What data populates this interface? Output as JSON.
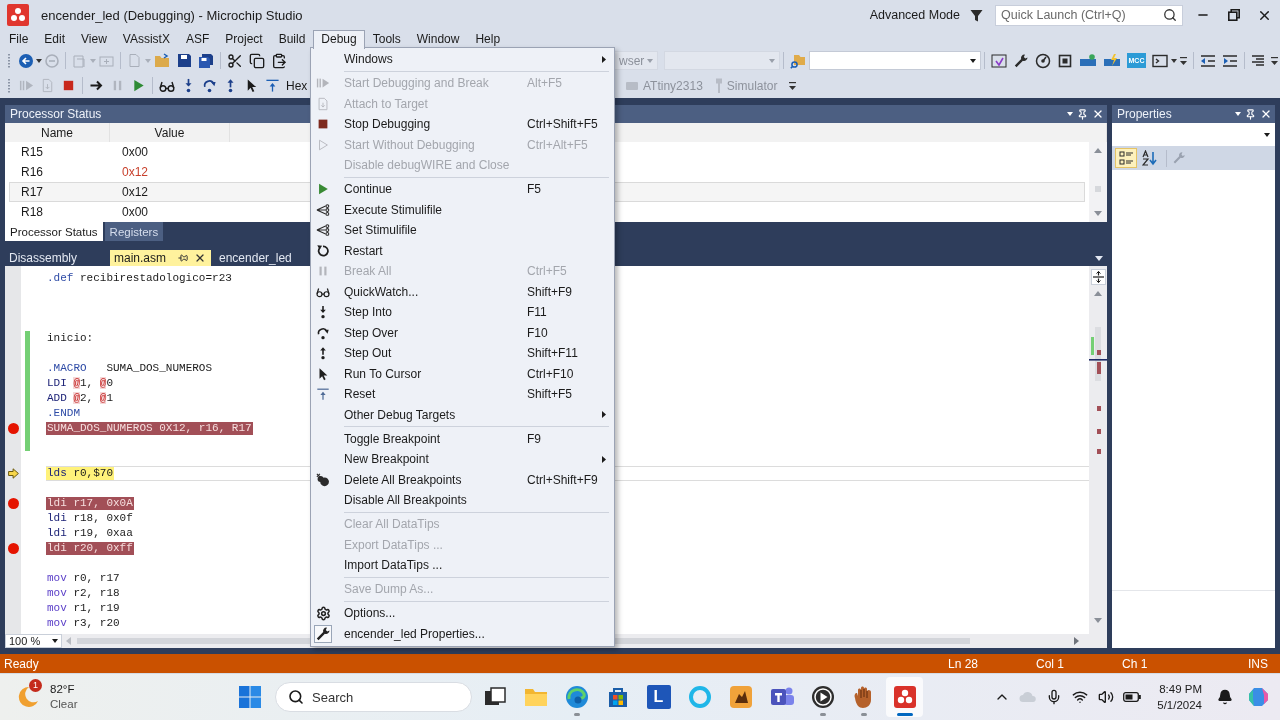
{
  "window": {
    "title": "encender_led (Debugging) - Microchip Studio",
    "mode": "Advanced Mode",
    "quick_launch": {
      "placeholder": "Quick Launch (Ctrl+Q)"
    }
  },
  "menu_bar": [
    {
      "label": "File",
      "selected": false
    },
    {
      "label": "Edit",
      "selected": false
    },
    {
      "label": "View",
      "selected": false
    },
    {
      "label": "VAssistX",
      "selected": false
    },
    {
      "label": "ASF",
      "selected": false
    },
    {
      "label": "Project",
      "selected": false
    },
    {
      "label": "Build",
      "selected": false
    },
    {
      "label": "Debug",
      "selected": true
    },
    {
      "label": "Tools",
      "selected": false
    },
    {
      "label": "Window",
      "selected": false
    },
    {
      "label": "Help",
      "selected": false
    }
  ],
  "toolbar": {
    "hex": "Hex",
    "browser_dropdown": "wser",
    "extension_tile": "MCC",
    "device": "ATtiny2313",
    "debugger": "Simulator"
  },
  "processor_status": {
    "title": "Processor Status",
    "columns": [
      "Name",
      "Value"
    ],
    "rows": [
      {
        "name": "R15",
        "value": "0x00",
        "changed": false,
        "selected": false
      },
      {
        "name": "R16",
        "value": "0x12",
        "changed": true,
        "selected": false
      },
      {
        "name": "R17",
        "value": "0x12",
        "changed": false,
        "selected": true
      },
      {
        "name": "R18",
        "value": "0x00",
        "changed": false,
        "selected": false
      }
    ],
    "tabs": [
      {
        "label": "Processor Status",
        "selected": true
      },
      {
        "label": "Registers",
        "selected": false
      }
    ]
  },
  "document_tabs": [
    {
      "label": "Disassembly",
      "selected": false
    },
    {
      "label": "main.asm",
      "selected": true
    },
    {
      "label": "encender_led",
      "selected": false
    }
  ],
  "editor": {
    "lines": [
      {
        "tokens": [
          {
            "kind": "directive",
            "text": ".def"
          },
          {
            "kind": "plain",
            "text": " recibirestadologico=r23"
          }
        ],
        "breakpoint": false,
        "current": false,
        "changed": false
      },
      {
        "breakpoint": false,
        "current": false,
        "changed": false
      },
      {
        "breakpoint": false,
        "current": false,
        "changed": false
      },
      {
        "breakpoint": false,
        "current": false,
        "changed": false
      },
      {
        "tokens": [
          {
            "kind": "plain",
            "text": "inicio:"
          }
        ],
        "breakpoint": false,
        "current": false,
        "changed": true
      },
      {
        "breakpoint": false,
        "current": false,
        "changed": true
      },
      {
        "tokens": [
          {
            "kind": "directive",
            "text": ".MACRO"
          },
          {
            "kind": "plain",
            "text": "   SUMA_DOS_NUMEROS"
          }
        ],
        "breakpoint": false,
        "current": false,
        "changed": true
      },
      {
        "tokens": [
          {
            "kind": "instruction",
            "text": "LDI "
          },
          {
            "kind": "macro_param",
            "text": "@"
          },
          {
            "kind": "plain",
            "text": "1, "
          },
          {
            "kind": "macro_param",
            "text": "@"
          },
          {
            "kind": "plain",
            "text": "0"
          }
        ],
        "breakpoint": false,
        "current": false,
        "changed": true
      },
      {
        "tokens": [
          {
            "kind": "instruction",
            "text": "ADD "
          },
          {
            "kind": "macro_param",
            "text": "@"
          },
          {
            "kind": "plain",
            "text": "2, "
          },
          {
            "kind": "macro_param",
            "text": "@"
          },
          {
            "kind": "plain",
            "text": "1"
          }
        ],
        "breakpoint": false,
        "current": false,
        "changed": true
      },
      {
        "tokens": [
          {
            "kind": "directive",
            "text": ".ENDM"
          }
        ],
        "breakpoint": false,
        "current": false,
        "changed": true
      },
      {
        "tokens": [
          {
            "kind": "plain",
            "text": "SUMA_DOS_NUMEROS 0X12, r16, R17"
          }
        ],
        "breakpoint": true,
        "current": false,
        "changed": true
      },
      {
        "breakpoint": false,
        "current": false,
        "changed": true
      },
      {
        "breakpoint": false,
        "current": false,
        "changed": false
      },
      {
        "tokens": [
          {
            "kind": "instruction",
            "text": "lds"
          },
          {
            "kind": "plain",
            "text": " r0,$70"
          }
        ],
        "breakpoint": false,
        "current": true,
        "changed": false
      },
      {
        "breakpoint": false,
        "current": false,
        "changed": false
      },
      {
        "tokens": [
          {
            "kind": "instruction",
            "text": "ldi"
          },
          {
            "kind": "plain",
            "text": " r17, 0x0A"
          }
        ],
        "breakpoint": true,
        "current": false,
        "changed": false
      },
      {
        "tokens": [
          {
            "kind": "instruction",
            "text": "ldi"
          },
          {
            "kind": "plain",
            "text": " r18, 0x0f"
          }
        ],
        "breakpoint": false,
        "current": false,
        "changed": false
      },
      {
        "tokens": [
          {
            "kind": "instruction",
            "text": "ldi"
          },
          {
            "kind": "plain",
            "text": " r19, 0xaa"
          }
        ],
        "breakpoint": false,
        "current": false,
        "changed": false
      },
      {
        "tokens": [
          {
            "kind": "instruction",
            "text": "ldi"
          },
          {
            "kind": "plain",
            "text": " r20, 0xff"
          }
        ],
        "breakpoint": true,
        "current": false,
        "changed": false
      },
      {
        "breakpoint": false,
        "current": false,
        "changed": false
      },
      {
        "tokens": [
          {
            "kind": "transfer",
            "text": "mov"
          },
          {
            "kind": "plain",
            "text": " r0, r17"
          }
        ],
        "breakpoint": false,
        "current": false,
        "changed": false
      },
      {
        "tokens": [
          {
            "kind": "transfer",
            "text": "mov"
          },
          {
            "kind": "plain",
            "text": " r2, r18"
          }
        ],
        "breakpoint": false,
        "current": false,
        "changed": false
      },
      {
        "tokens": [
          {
            "kind": "transfer",
            "text": "mov"
          },
          {
            "kind": "plain",
            "text": " r1, r19"
          }
        ],
        "breakpoint": false,
        "current": false,
        "changed": false
      },
      {
        "tokens": [
          {
            "kind": "transfer",
            "text": "mov"
          },
          {
            "kind": "plain",
            "text": " r3, r20"
          }
        ],
        "breakpoint": false,
        "current": false,
        "changed": false
      }
    ],
    "zoom": "100 %"
  },
  "properties": {
    "title": "Properties",
    "sort_buttons": [
      {
        "selected": true
      },
      {
        "selected": false
      }
    ]
  },
  "debug_menu": {
    "groups": [
      [
        {
          "label": "Windows",
          "submenu": true,
          "disabled": false
        }
      ],
      [
        {
          "label": "Start Debugging and Break",
          "shortcut": "Alt+F5",
          "submenu": false,
          "disabled": true
        },
        {
          "label": "Attach to Target",
          "submenu": false,
          "disabled": true
        },
        {
          "label": "Stop Debugging",
          "shortcut": "Ctrl+Shift+F5",
          "submenu": false,
          "disabled": false
        },
        {
          "label": "Start Without Debugging",
          "shortcut": "Ctrl+Alt+F5",
          "submenu": false,
          "disabled": true
        },
        {
          "label": "Disable debugWIRE and Close",
          "submenu": false,
          "disabled": true
        }
      ],
      [
        {
          "label": "Continue",
          "shortcut": "F5",
          "submenu": false,
          "disabled": false
        },
        {
          "label": "Execute Stimulifile",
          "submenu": false,
          "disabled": false
        },
        {
          "label": "Set Stimulifile",
          "submenu": false,
          "disabled": false
        },
        {
          "label": "Restart",
          "submenu": false,
          "disabled": false
        },
        {
          "label": "Break All",
          "shortcut": "Ctrl+F5",
          "submenu": false,
          "disabled": true
        },
        {
          "label": "QuickWatch...",
          "shortcut": "Shift+F9",
          "submenu": false,
          "disabled": false
        },
        {
          "label": "Step Into",
          "shortcut": "F11",
          "submenu": false,
          "disabled": false
        },
        {
          "label": "Step Over",
          "shortcut": "F10",
          "submenu": false,
          "disabled": false
        },
        {
          "label": "Step Out",
          "shortcut": "Shift+F11",
          "submenu": false,
          "disabled": false
        },
        {
          "label": "Run To Cursor",
          "shortcut": "Ctrl+F10",
          "submenu": false,
          "disabled": false
        },
        {
          "label": "Reset",
          "shortcut": "Shift+F5",
          "submenu": false,
          "disabled": false
        },
        {
          "label": "Other Debug Targets",
          "submenu": true,
          "disabled": false
        }
      ],
      [
        {
          "label": "Toggle Breakpoint",
          "shortcut": "F9",
          "submenu": false,
          "disabled": false
        },
        {
          "label": "New Breakpoint",
          "submenu": true,
          "disabled": false
        },
        {
          "label": "Delete All Breakpoints",
          "shortcut": "Ctrl+Shift+F9",
          "submenu": false,
          "disabled": false
        },
        {
          "label": "Disable All Breakpoints",
          "submenu": false,
          "disabled": false
        }
      ],
      [
        {
          "label": "Clear All DataTips",
          "submenu": false,
          "disabled": true
        },
        {
          "label": "Export DataTips ...",
          "submenu": false,
          "disabled": true
        },
        {
          "label": "Import DataTips ...",
          "submenu": false,
          "disabled": false
        }
      ],
      [
        {
          "label": "Save Dump As...",
          "submenu": false,
          "disabled": true
        }
      ],
      [
        {
          "label": "Options...",
          "submenu": false,
          "disabled": false
        },
        {
          "label": "encender_led Properties...",
          "submenu": false,
          "disabled": false
        }
      ]
    ]
  },
  "status_bar": {
    "state": "Ready",
    "line": "Ln 28",
    "column": "Col 1",
    "character": "Ch 1",
    "mode": "INS"
  },
  "taskbar": {
    "weather": {
      "badge": "1",
      "temperature": "82°F",
      "condition": "Clear"
    },
    "search": {
      "placeholder": "Search"
    },
    "apps": [
      {
        "running": false,
        "active": false
      },
      {
        "running": false,
        "active": false
      },
      {
        "running": true,
        "active": false
      },
      {
        "running": false,
        "active": false
      },
      {
        "label": "L",
        "running": false,
        "active": false
      },
      {
        "running": false,
        "active": false
      },
      {
        "running": false,
        "active": false
      },
      {
        "running": false,
        "active": false
      },
      {
        "running": true,
        "active": false
      },
      {
        "running": true,
        "active": false
      },
      {
        "running": true,
        "active": true
      }
    ],
    "clock": {
      "time": "8:49 PM",
      "date": "5/1/2024"
    }
  }
}
